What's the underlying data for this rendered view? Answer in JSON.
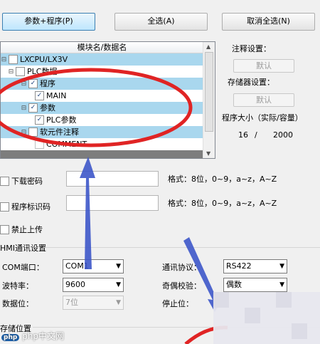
{
  "buttons": {
    "params_program": "参数+程序(P)",
    "select_all": "全选(A)",
    "deselect_all": "取消全选(N)"
  },
  "tree": {
    "header": "模块名/数据名",
    "rows": [
      {
        "label": "LXCPU/LX3V",
        "checked": false
      },
      {
        "label": "PLC数据",
        "checked": false
      },
      {
        "label": "程序",
        "checked": true
      },
      {
        "label": "MAIN",
        "checked": true
      },
      {
        "label": "参数",
        "checked": true
      },
      {
        "label": "PLC参数",
        "checked": true
      },
      {
        "label": "软元件注释",
        "checked": false
      },
      {
        "label": "COMMENT",
        "checked": false
      }
    ]
  },
  "right_panel": {
    "comment_setting": "注释设置：",
    "default1": "默认",
    "memory_setting": "存储器设置：",
    "default2": "默认",
    "program_size": "程序大小（实际/容量）",
    "used": "16",
    "slash": "/",
    "capacity": "2000"
  },
  "options": {
    "download_password": "下载密码",
    "format1": "格式：8位，0~9，a~z，A~Z",
    "program_id": "程序标识码",
    "format2": "格式：8位，0~9，a~z，A~Z",
    "forbid_upload": "禁止上传"
  },
  "hmi": {
    "section_title": "HMI通讯设置",
    "com_label": "COM端口：",
    "com_value": "COM1",
    "protocol_label": "通讯协议：",
    "protocol_value": "RS422",
    "baud_label": "波特率：",
    "baud_value": "9600",
    "parity_label": "奇偶校验：",
    "parity_value": "偶数",
    "databits_label": "数据位：",
    "databits_value": "7位",
    "stopbits_label": "停止位："
  },
  "bottom": {
    "position_label": "存储位置",
    "watermark": "php中文网"
  }
}
